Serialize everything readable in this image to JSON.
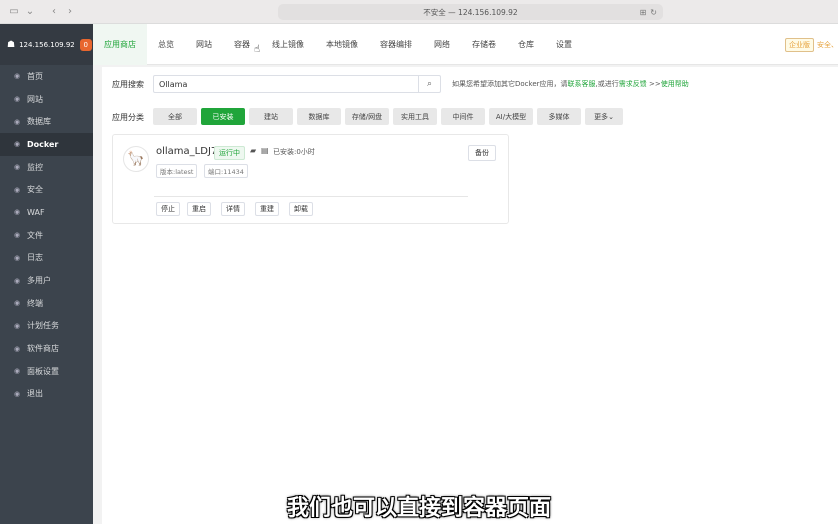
{
  "browser": {
    "address": "不安全 — 124.156.109.92"
  },
  "sidebar": {
    "server_ip": "124.156.109.92",
    "badge": "0",
    "items": [
      {
        "label": "首页",
        "icon": "home-icon"
      },
      {
        "label": "网站",
        "icon": "globe-icon"
      },
      {
        "label": "数据库",
        "icon": "database-icon"
      },
      {
        "label": "Docker",
        "icon": "docker-icon",
        "active": true
      },
      {
        "label": "监控",
        "icon": "monitor-icon"
      },
      {
        "label": "安全",
        "icon": "shield-icon"
      },
      {
        "label": "WAF",
        "icon": "waf-icon"
      },
      {
        "label": "文件",
        "icon": "folder-icon"
      },
      {
        "label": "日志",
        "icon": "log-icon"
      },
      {
        "label": "多用户",
        "icon": "users-icon"
      },
      {
        "label": "终端",
        "icon": "terminal-icon"
      },
      {
        "label": "计划任务",
        "icon": "clock-icon"
      },
      {
        "label": "软件商店",
        "icon": "store-icon"
      },
      {
        "label": "面板设置",
        "icon": "settings-icon"
      },
      {
        "label": "退出",
        "icon": "logout-icon"
      }
    ]
  },
  "topnav": {
    "tabs": [
      "应用商店",
      "总览",
      "网站",
      "容器",
      "线上镜像",
      "本地镜像",
      "容器编排",
      "网络",
      "存储卷",
      "仓库",
      "设置"
    ],
    "active_index": 0,
    "enterprise_label": "企业版",
    "security_label": "安全、"
  },
  "search": {
    "label": "应用搜索",
    "value": "Ollama",
    "hint_prefix": "如果您希望添加其它Docker应用，请",
    "hint_link1": "联系客服",
    "hint_middle": ",或进行",
    "hint_link2": "需求反馈",
    "hint_suffix": " >>",
    "hint_link3": "使用帮助"
  },
  "categories": {
    "label": "应用分类",
    "items": [
      "全部",
      "已安装",
      "建站",
      "数据库",
      "存储/网盘",
      "实用工具",
      "中间件",
      "AI/大模型",
      "多媒体",
      "更多"
    ],
    "active_index": 1
  },
  "app_card": {
    "name": "ollama_LDJ7",
    "status": "运行中",
    "installed": "已安装:0小时",
    "version": "版本:latest",
    "port": "端口:11434",
    "backup_label": "备份",
    "actions": [
      "停止",
      "重启",
      "详情",
      "重建",
      "卸载"
    ]
  },
  "subtitle": "我们也可以直接到容器页面",
  "colors": {
    "accent": "#20a53a",
    "sidebar_bg": "#3c444d",
    "badge": "#e8662e"
  }
}
